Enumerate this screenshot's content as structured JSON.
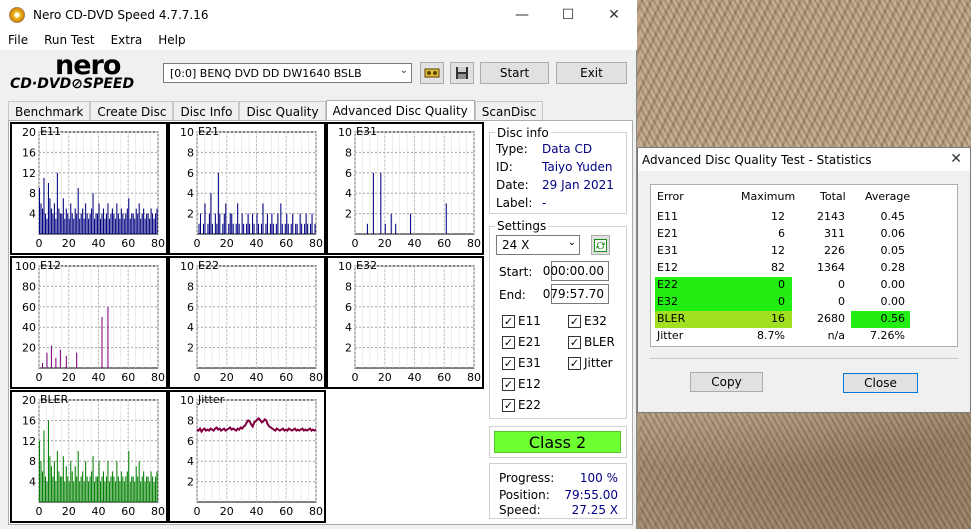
{
  "main_window": {
    "title": "Nero CD-DVD Speed 4.7.7.16",
    "minimize": "—",
    "maximize": "☐",
    "close": "✕"
  },
  "menu": [
    "File",
    "Run Test",
    "Extra",
    "Help"
  ],
  "logo": {
    "line1": "nero",
    "line2": "CD·DVD⊘SPEED"
  },
  "toolbar": {
    "drive": "[0:0]   BENQ DVD DD DW1640 BSLB",
    "start_label": "Start",
    "exit_label": "Exit",
    "eject_icon": "drive-icon",
    "save_icon": "floppy-icon"
  },
  "tabs": [
    {
      "label": "Benchmark"
    },
    {
      "label": "Create Disc"
    },
    {
      "label": "Disc Info"
    },
    {
      "label": "Disc Quality"
    },
    {
      "label": "Advanced Disc Quality",
      "active": true
    },
    {
      "label": "ScanDisc"
    }
  ],
  "disc_info": {
    "group_label": "Disc info",
    "type_label": "Type:",
    "type_value": "Data CD",
    "id_label": "ID:",
    "id_value": "Taiyo Yuden",
    "date_label": "Date:",
    "date_value": "29 Jan 2021",
    "label_label": "Label:",
    "label_value": "-"
  },
  "settings": {
    "group_label": "Settings",
    "speed": "24 X",
    "start_label": "Start:",
    "start_value": "000:00.00",
    "end_label": "End:",
    "end_value": "079:57.70",
    "checkboxes": [
      {
        "label": "E11",
        "checked": true
      },
      {
        "label": "E32",
        "checked": true
      },
      {
        "label": "E21",
        "checked": true
      },
      {
        "label": "BLER",
        "checked": true
      },
      {
        "label": "E31",
        "checked": true
      },
      {
        "label": "Jitter",
        "checked": true
      },
      {
        "label": "E12",
        "checked": true
      },
      {
        "label": "E22",
        "checked": true
      }
    ]
  },
  "result": {
    "class_label": "Class 2",
    "color": "#6eff33"
  },
  "progress": {
    "progress_label": "Progress:",
    "progress_value": "100 %",
    "position_label": "Position:",
    "position_value": "79:55.00",
    "speed_label": "Speed:",
    "speed_value": "27.25 X"
  },
  "chart_data": [
    {
      "type": "bar",
      "title": "E11",
      "color": "#000080",
      "ylim": [
        0,
        20
      ],
      "yticks": [
        "20",
        "16",
        "12",
        "8",
        "4"
      ],
      "xticks": [
        "0",
        "20",
        "40",
        "60",
        "80"
      ],
      "x_range": [
        0,
        80
      ],
      "values": [
        9,
        6,
        5,
        11,
        4,
        3,
        10,
        7,
        5,
        4,
        6,
        3,
        12,
        5,
        4,
        4,
        7,
        3,
        5,
        4,
        3,
        6,
        4,
        3,
        5,
        4,
        9,
        3,
        4,
        5,
        3,
        6,
        4,
        3,
        4,
        5,
        8,
        3,
        4,
        4,
        6,
        3,
        4,
        5,
        3,
        4,
        6,
        3,
        4,
        5,
        4,
        3,
        6,
        4,
        3,
        5,
        4,
        3,
        4,
        5,
        7,
        3,
        4,
        4,
        3,
        5,
        4,
        6,
        3,
        4,
        5,
        3,
        4,
        4,
        3,
        5,
        4,
        3,
        4,
        5
      ]
    },
    {
      "type": "bar",
      "title": "E21",
      "color": "#000080",
      "ylim": [
        0,
        10
      ],
      "yticks": [
        "10",
        "8",
        "6",
        "4",
        "2"
      ],
      "xticks": [
        "0",
        "20",
        "40",
        "60",
        "80"
      ],
      "x_range": [
        0,
        80
      ],
      "values": [
        0,
        1,
        2,
        0,
        1,
        3,
        0,
        1,
        2,
        4,
        1,
        0,
        2,
        1,
        6,
        2,
        0,
        1,
        2,
        3,
        0,
        1,
        2,
        2,
        1,
        0,
        1,
        3,
        1,
        0,
        2,
        1,
        0,
        1,
        2,
        1,
        0,
        2,
        1,
        0,
        2,
        1,
        0,
        1,
        3,
        0,
        1,
        2,
        0,
        1,
        2,
        1,
        0,
        1,
        2,
        0,
        3,
        1,
        0,
        1,
        2,
        1,
        0,
        1,
        2,
        0,
        1,
        1,
        0,
        2,
        1,
        0,
        1,
        2,
        1,
        0,
        1,
        2,
        0,
        1
      ]
    },
    {
      "type": "bar",
      "title": "E31",
      "color": "#000080",
      "ylim": [
        0,
        10
      ],
      "yticks": [
        "10",
        "8",
        "6",
        "4",
        "2"
      ],
      "xticks": [
        "0",
        "20",
        "40",
        "60",
        "80"
      ],
      "x_range": [
        0,
        80
      ],
      "values": [
        0,
        0,
        0,
        0,
        0,
        0,
        0,
        0,
        1,
        0,
        0,
        0,
        6,
        0,
        0,
        0,
        0,
        6,
        0,
        0,
        1,
        0,
        0,
        0,
        2,
        0,
        0,
        1,
        0,
        0,
        0,
        0,
        0,
        0,
        0,
        0,
        0,
        2,
        0,
        0,
        0,
        0,
        0,
        0,
        0,
        0,
        0,
        0,
        0,
        0,
        0,
        0,
        0,
        0,
        0,
        0,
        0,
        0,
        0,
        0,
        0,
        3,
        0,
        0,
        0,
        0,
        0,
        0,
        0,
        0,
        0,
        0,
        0,
        0,
        0,
        0,
        0,
        0,
        0,
        0
      ]
    },
    {
      "type": "bar",
      "title": "E12",
      "color": "#800080",
      "ylim": [
        0,
        100
      ],
      "yticks": [
        "100",
        "80",
        "60",
        "40",
        "20"
      ],
      "xticks": [
        "0",
        "20",
        "40",
        "60",
        "80"
      ],
      "x_range": [
        0,
        80
      ],
      "values": [
        0,
        0,
        5,
        0,
        0,
        15,
        0,
        0,
        22,
        0,
        0,
        10,
        0,
        0,
        18,
        0,
        0,
        0,
        12,
        0,
        0,
        0,
        0,
        0,
        0,
        15,
        0,
        0,
        0,
        0,
        0,
        0,
        0,
        0,
        0,
        0,
        0,
        0,
        0,
        0,
        0,
        0,
        50,
        0,
        0,
        0,
        60,
        0,
        0,
        0,
        0,
        0,
        0,
        0,
        0,
        0,
        0,
        0,
        0,
        0,
        0,
        0,
        0,
        0,
        0,
        0,
        0,
        0,
        0,
        0,
        0,
        0,
        0,
        0,
        0,
        0,
        0,
        0,
        0,
        0
      ]
    },
    {
      "type": "bar",
      "title": "E22",
      "color": "#000080",
      "ylim": [
        0,
        10
      ],
      "yticks": [
        "10",
        "8",
        "6",
        "4",
        "2"
      ],
      "xticks": [
        "0",
        "20",
        "40",
        "60",
        "80"
      ],
      "x_range": [
        0,
        80
      ],
      "values": []
    },
    {
      "type": "bar",
      "title": "E32",
      "color": "#000080",
      "ylim": [
        0,
        10
      ],
      "yticks": [
        "10",
        "8",
        "6",
        "4",
        "2"
      ],
      "xticks": [
        "0",
        "20",
        "40",
        "60",
        "80"
      ],
      "x_range": [
        0,
        80
      ],
      "values": []
    },
    {
      "type": "bar",
      "title": "BLER",
      "color": "#008000",
      "ylim": [
        0,
        20
      ],
      "yticks": [
        "20",
        "16",
        "12",
        "8",
        "4"
      ],
      "xticks": [
        "0",
        "20",
        "40",
        "60",
        "80"
      ],
      "x_range": [
        0,
        80
      ],
      "values": [
        12,
        8,
        6,
        14,
        5,
        4,
        16,
        9,
        7,
        5,
        8,
        4,
        10,
        6,
        5,
        5,
        9,
        4,
        7,
        5,
        4,
        8,
        6,
        4,
        7,
        5,
        10,
        4,
        5,
        6,
        4,
        8,
        5,
        4,
        5,
        6,
        9,
        4,
        5,
        5,
        8,
        4,
        5,
        6,
        4,
        5,
        8,
        4,
        5,
        6,
        5,
        4,
        8,
        5,
        4,
        6,
        5,
        4,
        5,
        6,
        10,
        4,
        5,
        5,
        4,
        7,
        5,
        8,
        4,
        5,
        6,
        4,
        5,
        5,
        4,
        6,
        5,
        4,
        5,
        6
      ]
    },
    {
      "type": "line",
      "title": "Jitter",
      "color": "#800040",
      "ylim": [
        0,
        10
      ],
      "yticks": [
        "10",
        "8",
        "6",
        "4",
        "2"
      ],
      "xticks": [
        "0",
        "20",
        "40",
        "60",
        "80"
      ],
      "x_range": [
        0,
        80
      ],
      "values": [
        7.1,
        7.0,
        7.2,
        6.9,
        7.1,
        7.2,
        7.0,
        7.1,
        7.0,
        7.2,
        7.1,
        7.0,
        7.2,
        7.3,
        7.1,
        7.2,
        7.0,
        7.1,
        7.2,
        7.0,
        7.1,
        7.2,
        7.3,
        7.1,
        7.2,
        7.1,
        7.0,
        7.2,
        7.1,
        7.3,
        7.2,
        7.4,
        7.5,
        7.8,
        8.0,
        7.9,
        7.6,
        7.4,
        7.8,
        7.9,
        8.1,
        8.2,
        8.0,
        7.8,
        7.9,
        8.1,
        8.0,
        7.6,
        7.4,
        7.3,
        7.2,
        7.1,
        7.0,
        7.2,
        7.1,
        7.0,
        7.1,
        7.2,
        7.0,
        7.1,
        7.0,
        7.2,
        7.1,
        7.0,
        7.1,
        7.2,
        7.0,
        7.1,
        7.0,
        7.1,
        7.2,
        7.0,
        7.1,
        7.0,
        7.1,
        7.2,
        7.0,
        7.1,
        7.0,
        7.1
      ]
    }
  ],
  "stats_dialog": {
    "title": "Advanced Disc Quality Test - Statistics",
    "close": "✕",
    "headers": [
      "Error",
      "Maximum",
      "Total",
      "Average"
    ],
    "rows": [
      {
        "name": "E11",
        "max": "12",
        "total": "2143",
        "avg": "0.45"
      },
      {
        "name": "E21",
        "max": "6",
        "total": "311",
        "avg": "0.06"
      },
      {
        "name": "E31",
        "max": "12",
        "total": "226",
        "avg": "0.05"
      },
      {
        "name": "E12",
        "max": "82",
        "total": "1364",
        "avg": "0.28"
      },
      {
        "name": "E22",
        "max": "0",
        "total": "0",
        "avg": "0.00"
      },
      {
        "name": "E32",
        "max": "0",
        "total": "0",
        "avg": "0.00"
      },
      {
        "name": "BLER",
        "max": "16",
        "total": "2680",
        "avg": "0.56"
      },
      {
        "name": "Jitter",
        "max": "8.7%",
        "total": "n/a",
        "avg": "7.26%"
      }
    ],
    "copy_label": "Copy",
    "close_label": "Close"
  }
}
